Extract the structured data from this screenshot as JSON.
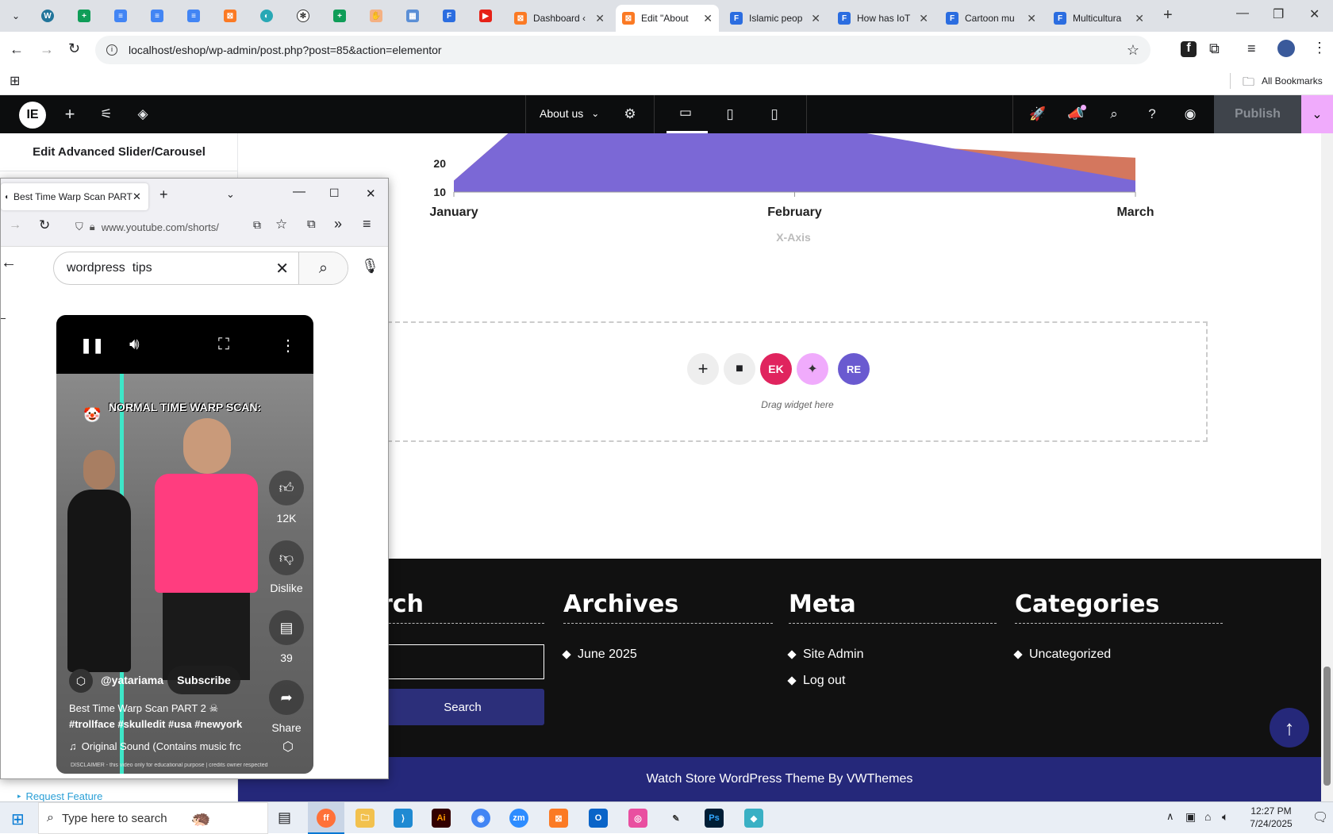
{
  "tabs": [
    {
      "title": "Dashboard ‹",
      "active": false
    },
    {
      "title": "Edit \"About",
      "active": true
    },
    {
      "title": "Islamic peop",
      "active": false
    },
    {
      "title": "How has IoT",
      "active": false
    },
    {
      "title": "Cartoon mu",
      "active": false
    },
    {
      "title": "Multicultura",
      "active": false
    }
  ],
  "address": {
    "url": "localhost/eshop/wp-admin/post.php?post=85&action=elementor"
  },
  "bookmarks": {
    "all_label": "All Bookmarks"
  },
  "elementor": {
    "page_title": "About us",
    "publish_label": "Publish",
    "panel_title": "Edit Advanced Slider/Carousel",
    "request_feature": "Request Feature"
  },
  "chart_data": {
    "type": "area",
    "categories": [
      "January",
      "February",
      "March"
    ],
    "x_axis_title": "X-Axis",
    "y_ticks_visible": [
      20,
      10
    ],
    "series": [
      {
        "values": [
          null,
          28,
          22
        ],
        "color": "#d4775e"
      },
      {
        "values": [
          null,
          35,
          14
        ],
        "color": "#7b68d6"
      }
    ],
    "colors": {
      "fill_area": "#7b68d6",
      "fill_orange": "#d4775e"
    }
  },
  "dropzone": {
    "hint": "Drag widget here"
  },
  "footer": {
    "search_heading": "rch",
    "search_button": "Search",
    "archives_heading": "Archives",
    "archives_items": [
      "June 2025"
    ],
    "meta_heading": "Meta",
    "meta_items": [
      "Site Admin",
      "Log out"
    ],
    "categories_heading": "Categories",
    "categories_items": [
      "Uncategorized"
    ],
    "credit": "Watch Store WordPress Theme By VWThemes"
  },
  "firefox": {
    "tab_title": "Best Time Warp Scan PART",
    "url": "www.youtube.com/shorts/",
    "search_value": "wordpress  tips"
  },
  "video": {
    "overlay_caption": "NORMAL TIME WARP SCAN:",
    "likes": "12K",
    "dislike_label": "Dislike",
    "comments": "39",
    "share_label": "Share",
    "channel": "@yatariama",
    "subscribe_label": "Subscribe",
    "title": "Best Time Warp Scan PART 2 ☠",
    "hashtags": "#trollface #skulledit #usa #newyork",
    "sound": "Original Sound (Contains music frc",
    "disclaimer": "DISCLAIMER - this video only for educational purpose | credits owner respected"
  },
  "taskbar": {
    "search_placeholder": "Type here to search",
    "time": "12:27 PM",
    "date": "7/24/2025"
  }
}
